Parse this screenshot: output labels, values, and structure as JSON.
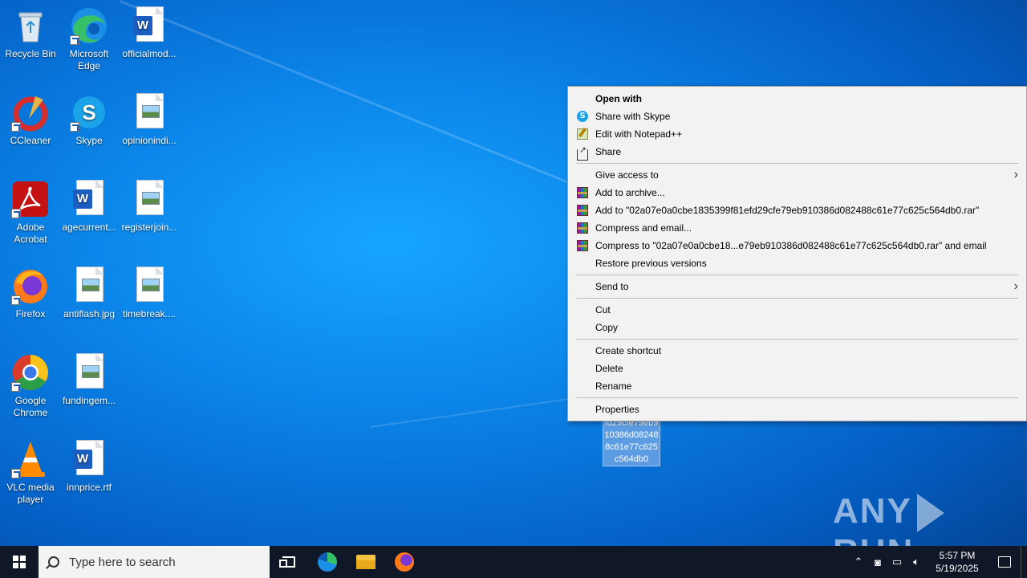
{
  "desktop": {
    "icons": [
      {
        "label": "Recycle Bin",
        "icon": "recycle-bin-icon"
      },
      {
        "label": "Microsoft Edge",
        "icon": "edge-icon"
      },
      {
        "label": "officialmod...",
        "icon": "word-doc-icon"
      },
      {
        "label": "CCleaner",
        "icon": "ccleaner-icon"
      },
      {
        "label": "Skype",
        "icon": "skype-icon"
      },
      {
        "label": "opinionindi...",
        "icon": "image-file-icon"
      },
      {
        "label": "Adobe Acrobat",
        "icon": "acrobat-icon"
      },
      {
        "label": "agecurrent...",
        "icon": "word-doc-icon"
      },
      {
        "label": "registerjoin...",
        "icon": "image-file-icon"
      },
      {
        "label": "Firefox",
        "icon": "firefox-icon"
      },
      {
        "label": "antiflash.jpg",
        "icon": "image-file-icon"
      },
      {
        "label": "timebreak....",
        "icon": "image-file-icon"
      },
      {
        "label": "Google Chrome",
        "icon": "chrome-icon"
      },
      {
        "label": "fundingem...",
        "icon": "image-file-icon"
      },
      {
        "label": "VLC media player",
        "icon": "vlc-icon"
      },
      {
        "label": "innprice.rtf",
        "icon": "word-doc-icon"
      }
    ],
    "selected_file_lines": [
      "fd29cfe79eb9",
      "10386d08248",
      "8c61e77c625",
      "c564db0"
    ]
  },
  "context_menu": {
    "items": [
      {
        "label": "Open with",
        "bold": true,
        "icon": ""
      },
      {
        "label": "Share with Skype",
        "icon": "skype-icon"
      },
      {
        "label": "Edit with Notepad++",
        "icon": "notepad-plus-plus-icon"
      },
      {
        "label": "Share",
        "icon": "share-icon"
      },
      {
        "label": "Give access to",
        "submenu": true
      },
      {
        "label": "Add to archive...",
        "icon": "winrar-icon"
      },
      {
        "label": "Add to \"02a07e0a0cbe1835399f81efd29cfe79eb910386d082488c61e77c625c564db0.rar\"",
        "icon": "winrar-icon"
      },
      {
        "label": "Compress and email...",
        "icon": "winrar-icon"
      },
      {
        "label": "Compress to \"02a07e0a0cbe18...e79eb910386d082488c61e77c625c564db0.rar\" and email",
        "icon": "winrar-icon"
      },
      {
        "label": "Restore previous versions"
      },
      {
        "label": "Send to",
        "submenu": true
      },
      {
        "label": "Cut"
      },
      {
        "label": "Copy"
      },
      {
        "label": "Create shortcut"
      },
      {
        "label": "Delete"
      },
      {
        "label": "Rename"
      },
      {
        "label": "Properties"
      }
    ]
  },
  "watermark": {
    "left": "ANY",
    "right": "RUN"
  },
  "taskbar": {
    "search_placeholder": "Type here to search",
    "time": "5:57 PM",
    "date": "5/19/2025"
  },
  "colors": {
    "taskbar": "#101828",
    "menu_bg": "#f2f2f2",
    "desktop": "#0b84e8"
  }
}
